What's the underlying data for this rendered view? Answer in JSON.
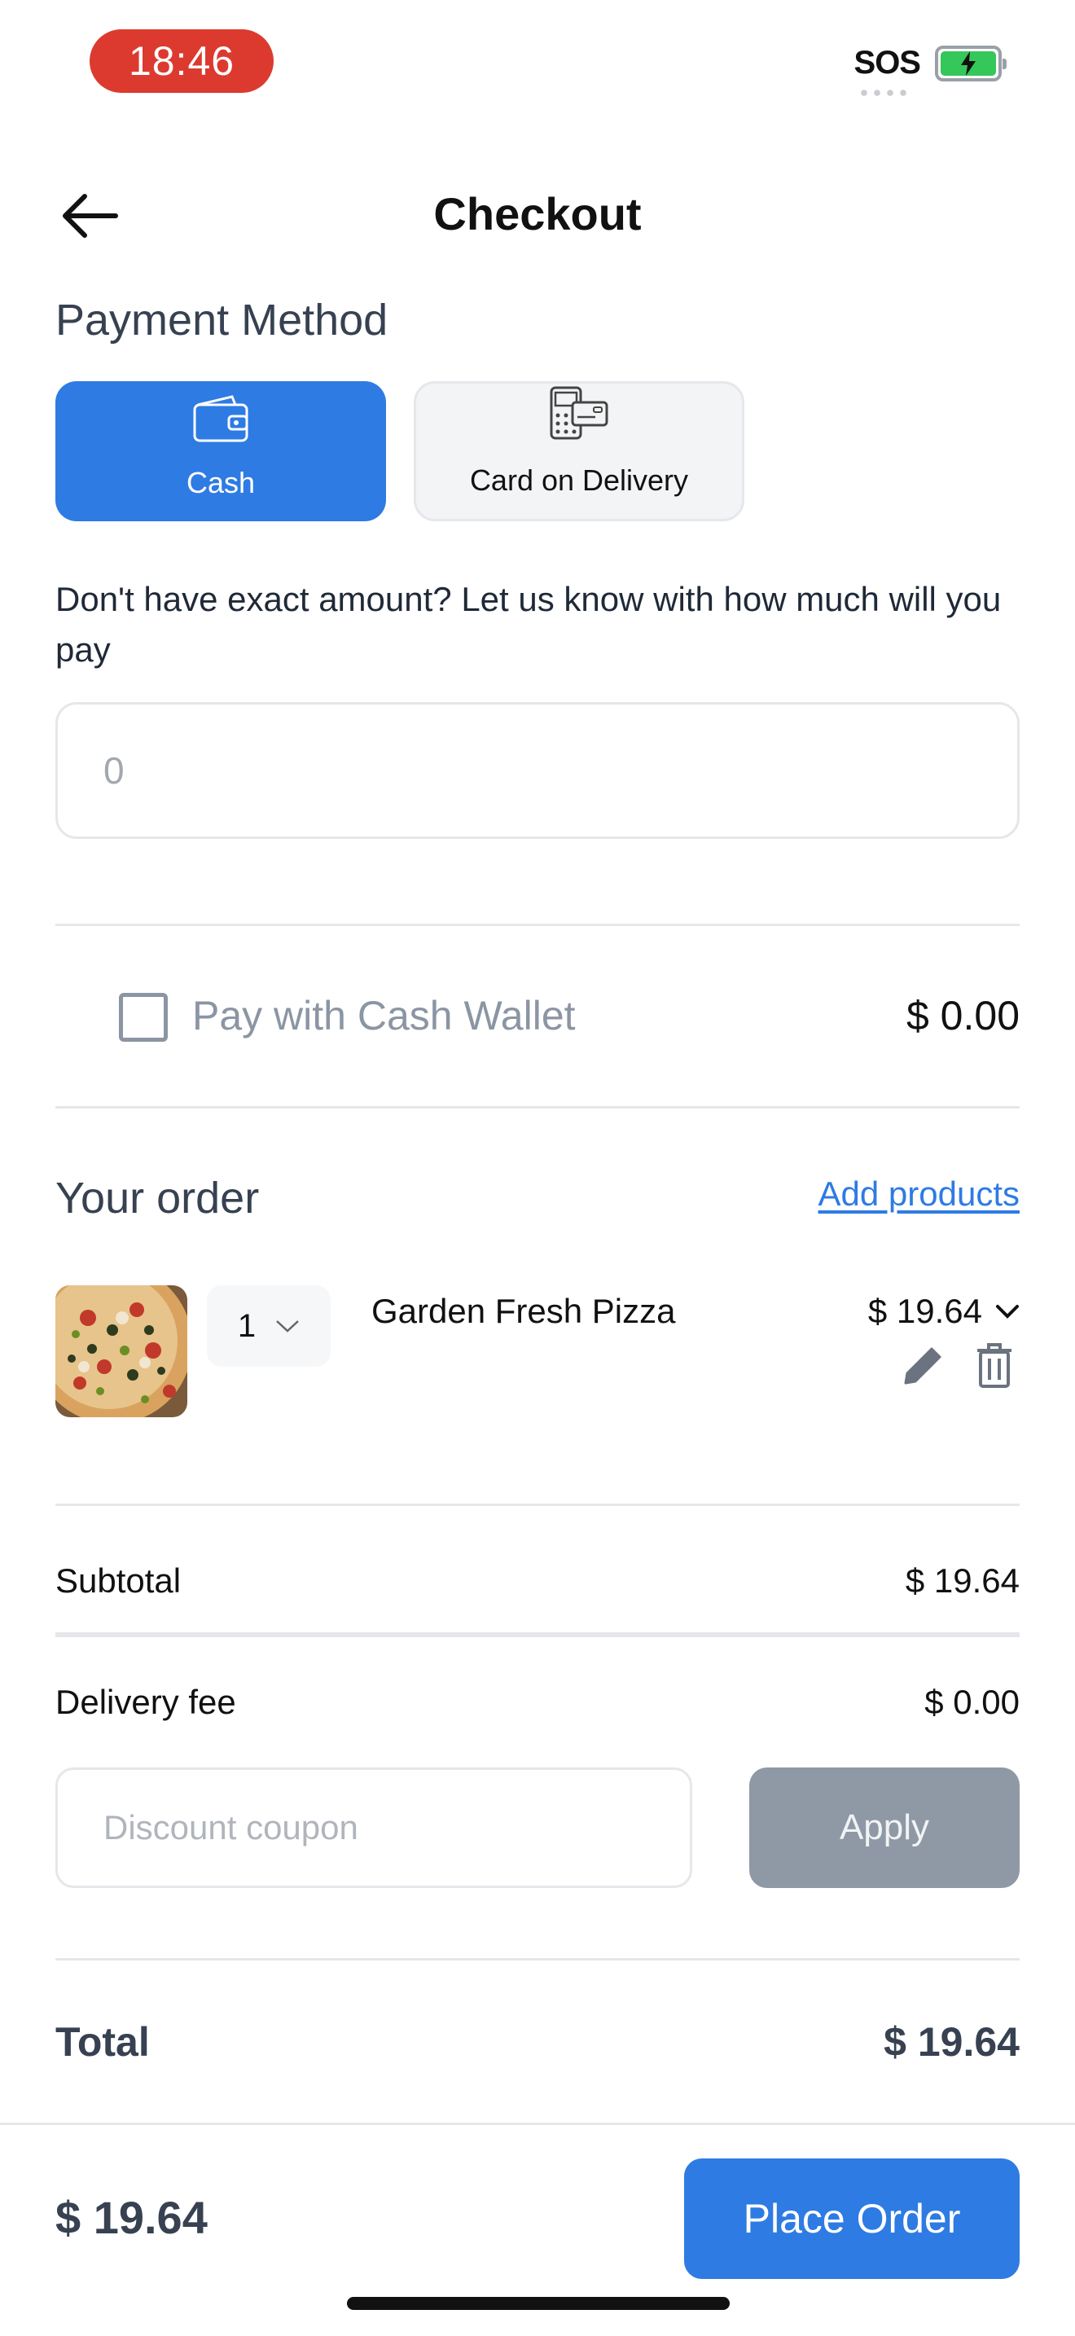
{
  "status_bar": {
    "time": "18:46",
    "carrier_status": "SOS",
    "battery_icon": "charging-battery-icon"
  },
  "header": {
    "title": "Checkout",
    "back_icon": "arrow-left-icon"
  },
  "payment": {
    "section_title": "Payment Method",
    "options": [
      {
        "label": "Cash",
        "icon": "wallet-icon",
        "selected": true
      },
      {
        "label": "Card on Delivery",
        "icon": "card-terminal-icon",
        "selected": false
      }
    ],
    "hint": "Don't have exact amount? Let us know with how much will you pay",
    "amount_placeholder": "0"
  },
  "wallet": {
    "label": "Pay with Cash Wallet",
    "amount": "$ 0.00",
    "checked": false
  },
  "order": {
    "title": "Your order",
    "add_products_label": "Add products",
    "items": [
      {
        "name": "Garden Fresh Pizza",
        "quantity": "1",
        "price": "$ 19.64"
      }
    ]
  },
  "summary": {
    "subtotal_label": "Subtotal",
    "subtotal_value": "$ 19.64",
    "delivery_label": "Delivery fee",
    "delivery_value": "$ 0.00",
    "coupon_placeholder": "Discount coupon",
    "apply_label": "Apply",
    "total_label": "Total",
    "total_value": "$ 19.64"
  },
  "footer": {
    "total": "$ 19.64",
    "place_order_label": "Place Order"
  },
  "colors": {
    "primary": "#2e7be3",
    "status_time_bg": "#dc3a2f",
    "apply_disabled": "#8e99a5",
    "muted_text": "#8b95a3"
  }
}
